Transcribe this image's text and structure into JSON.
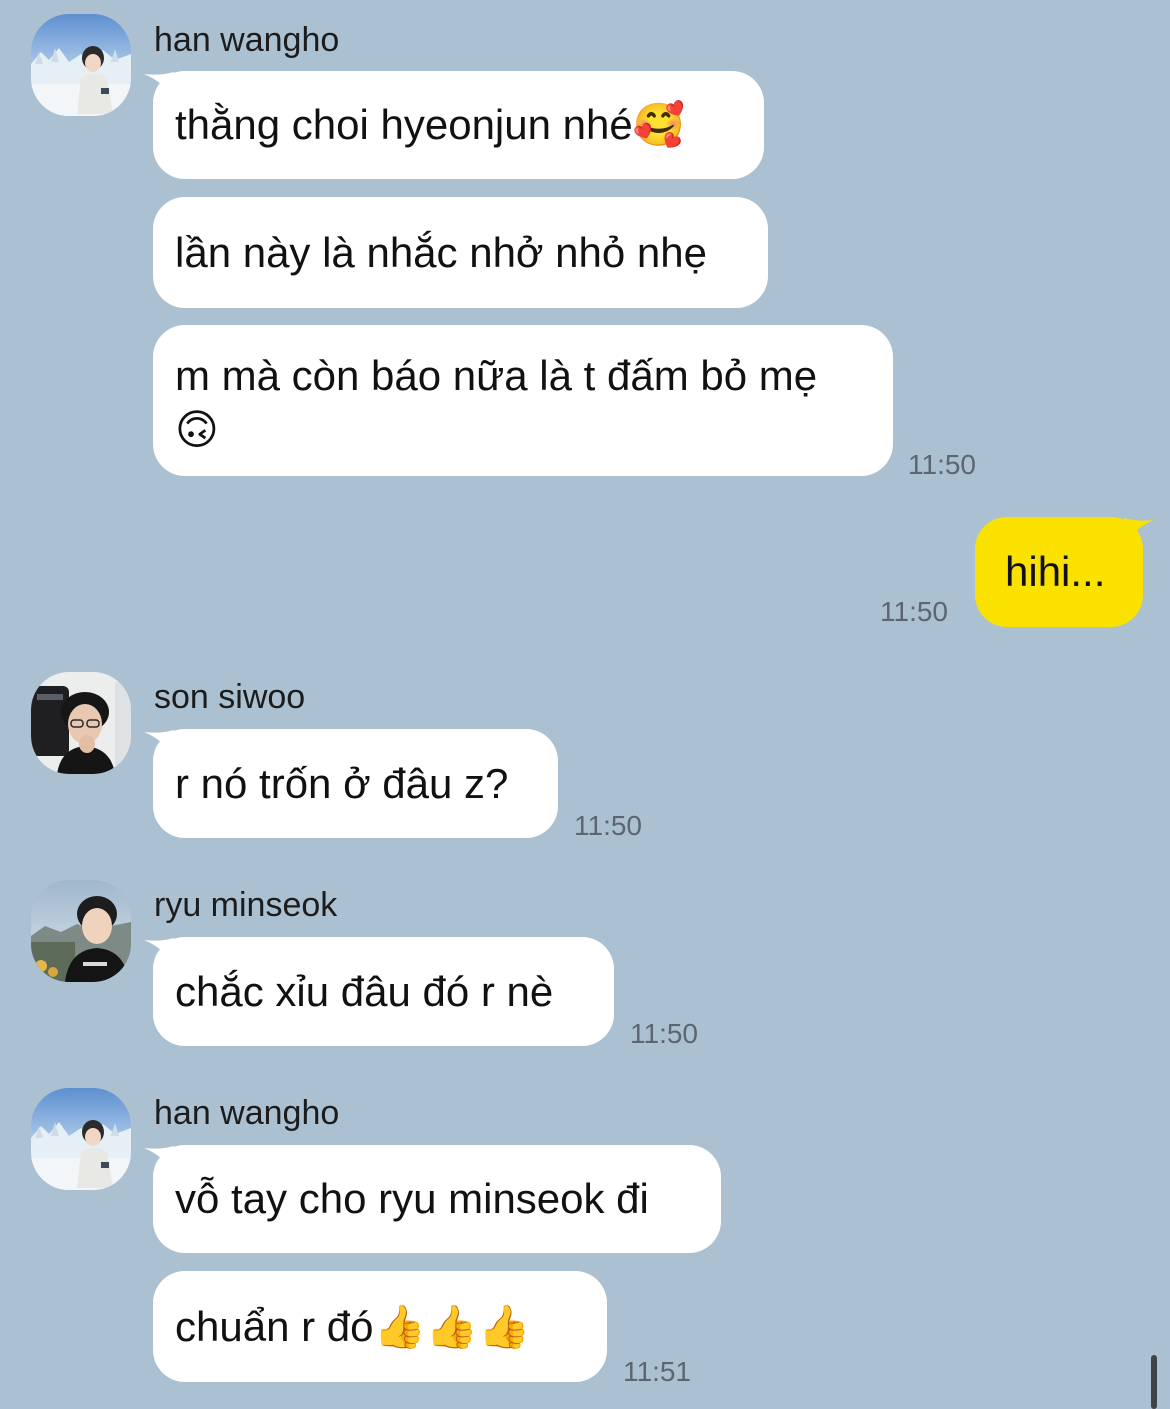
{
  "messages": [
    {
      "sender": "han wangho",
      "avatar": "han-wangho-avatar",
      "bubbles": [
        "thằng choi hyeonjun nhé🥰",
        "lần này là nhắc nhở nhỏ nhẹ",
        "m mà còn báo nữa là t đấm bỏ mẹ 🙃"
      ],
      "time": "11:50"
    },
    {
      "sender": "me",
      "bubbles": [
        "hihi..."
      ],
      "time": "11:50",
      "bubble_color": "#fae100"
    },
    {
      "sender": "son siwoo",
      "avatar": "son-siwoo-avatar",
      "bubbles": [
        "r nó trốn ở đâu z?"
      ],
      "time": "11:50"
    },
    {
      "sender": "ryu minseok",
      "avatar": "ryu-minseok-avatar",
      "bubbles": [
        "chắc xỉu đâu đó r nè"
      ],
      "time": "11:50"
    },
    {
      "sender": "han wangho",
      "avatar": "han-wangho-avatar",
      "bubbles": [
        "vỗ tay cho ryu minseok đi",
        "chuẩn r đó👍👍👍"
      ],
      "time": "11:51"
    }
  ],
  "theme": {
    "background": "#abc1d2",
    "incoming_bubble": "#ffffff",
    "outgoing_bubble": "#fae100"
  }
}
